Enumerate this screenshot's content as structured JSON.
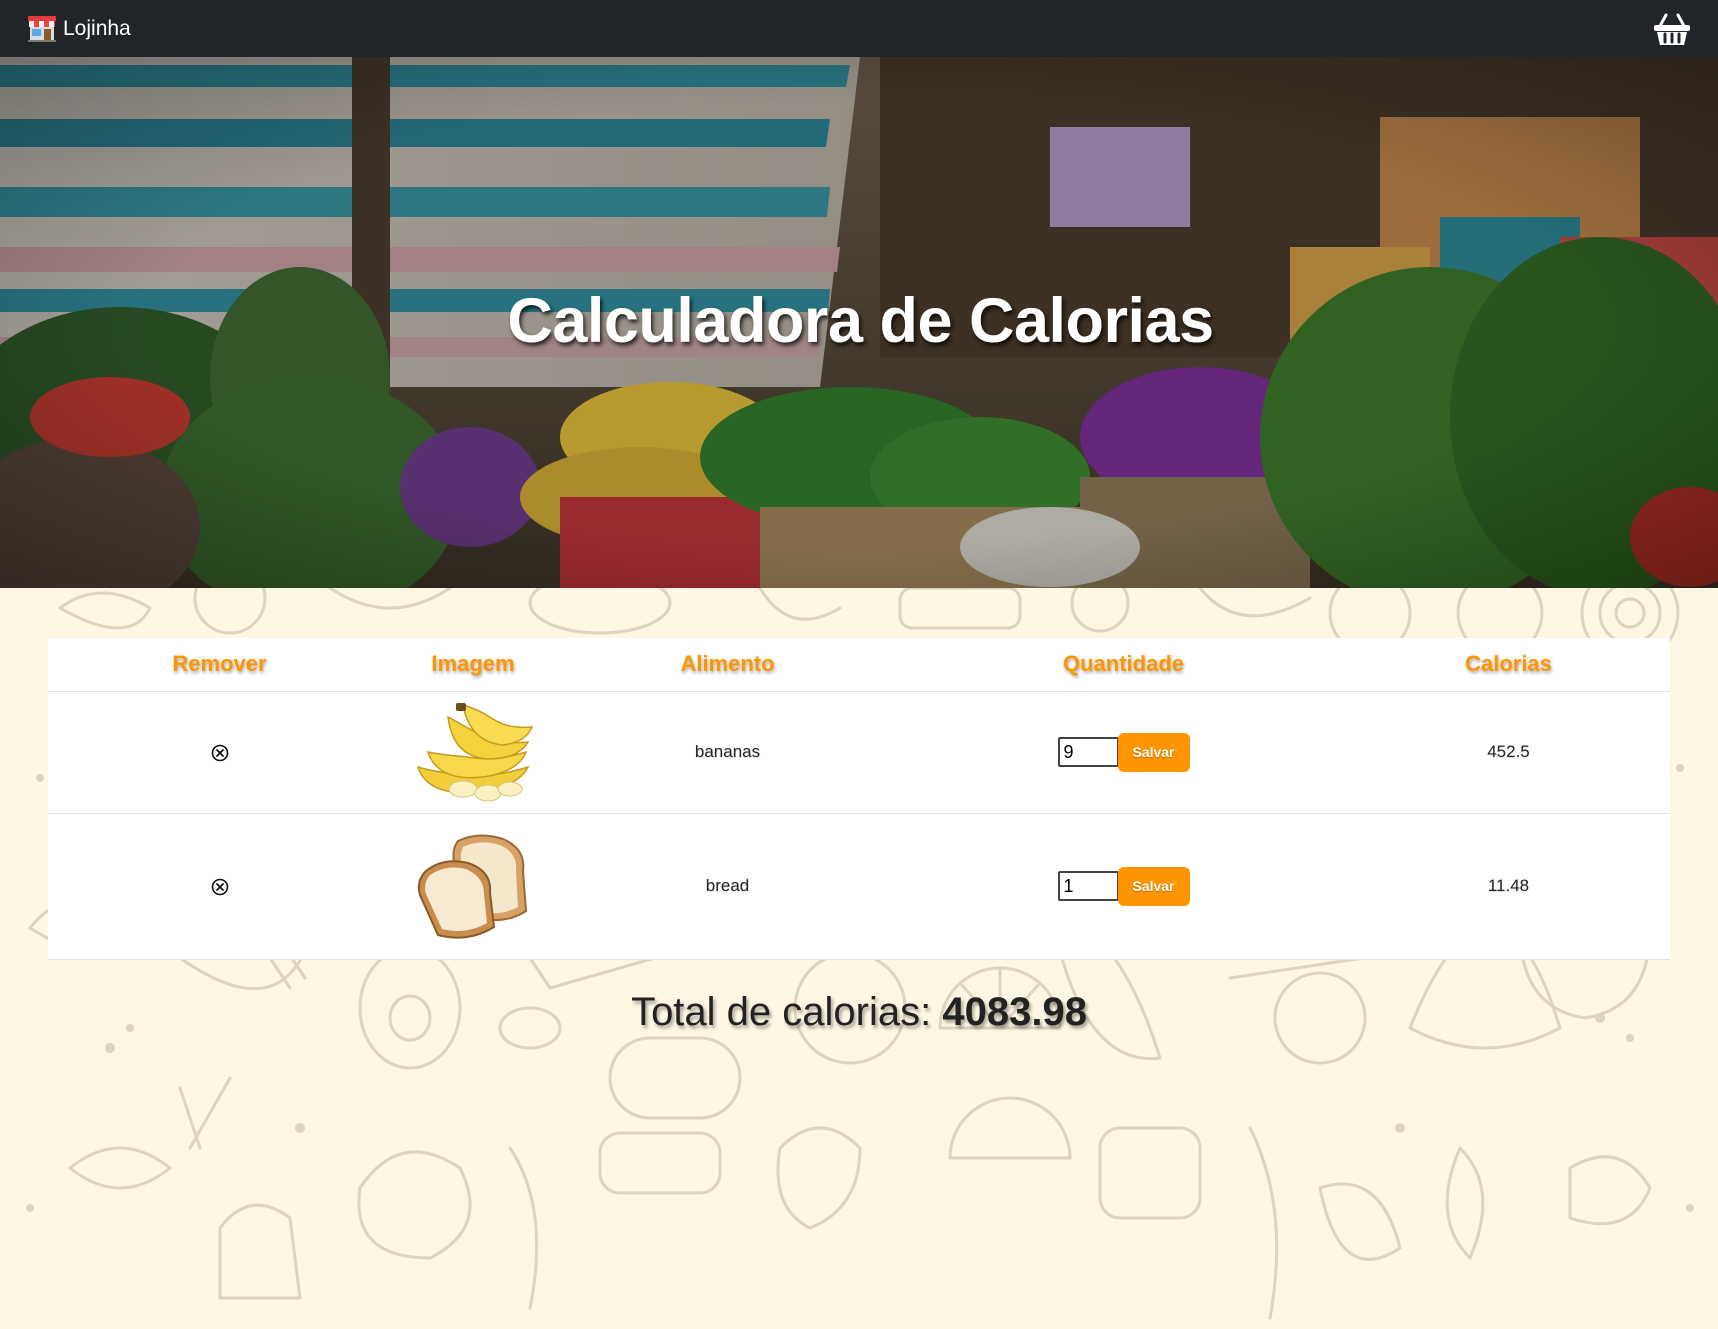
{
  "navbar": {
    "brand_label": "Lojinha",
    "brand_icon": "store-icon",
    "cart_icon": "basket-icon",
    "background_color": "#212529"
  },
  "hero": {
    "title": "Calculadora de Calorias"
  },
  "table": {
    "headers": {
      "remove": "Remover",
      "image": "Imagem",
      "food": "Alimento",
      "quantity": "Quantidade",
      "calories": "Calorias"
    },
    "header_color": "#ff9500",
    "rows": [
      {
        "remove_icon": "close-circle-icon",
        "image": "banana-image",
        "food": "bananas",
        "quantity": "9",
        "save_label": "Salvar",
        "calories": "452.5"
      },
      {
        "remove_icon": "close-circle-icon",
        "image": "bread-image",
        "food": "bread",
        "quantity": "1",
        "save_label": "Salvar",
        "calories": "11.48"
      }
    ]
  },
  "total": {
    "label": "Total de calorias:",
    "value": "4083.98"
  },
  "colors": {
    "accent": "#ff9500",
    "background": "#fdf6e2"
  }
}
